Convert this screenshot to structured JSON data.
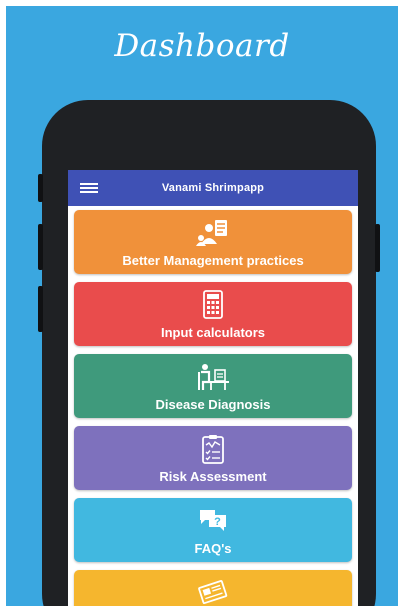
{
  "header": {
    "title": "Dashboard"
  },
  "app": {
    "title": "Vanami Shrimpapp",
    "menu_icon": "hamburger-icon"
  },
  "colors": {
    "background": "#3aa7e0",
    "appbar": "#3f51b5",
    "orange": "#f0913a",
    "red": "#e94c4c",
    "teal": "#3f9a7c",
    "purple": "#7e71bd",
    "sky": "#41b8e0",
    "yellow": "#f5b62e"
  },
  "cards": [
    {
      "label": "Better Management practices",
      "icon": "consultation-icon"
    },
    {
      "label": "Input calculators",
      "icon": "calculator-icon"
    },
    {
      "label": "Disease Diagnosis",
      "icon": "diagnosis-icon"
    },
    {
      "label": "Risk Assessment",
      "icon": "clipboard-checklist-icon"
    },
    {
      "label": "FAQ's",
      "icon": "faq-chat-icon"
    },
    {
      "label": "",
      "icon": "newspaper-icon"
    }
  ]
}
